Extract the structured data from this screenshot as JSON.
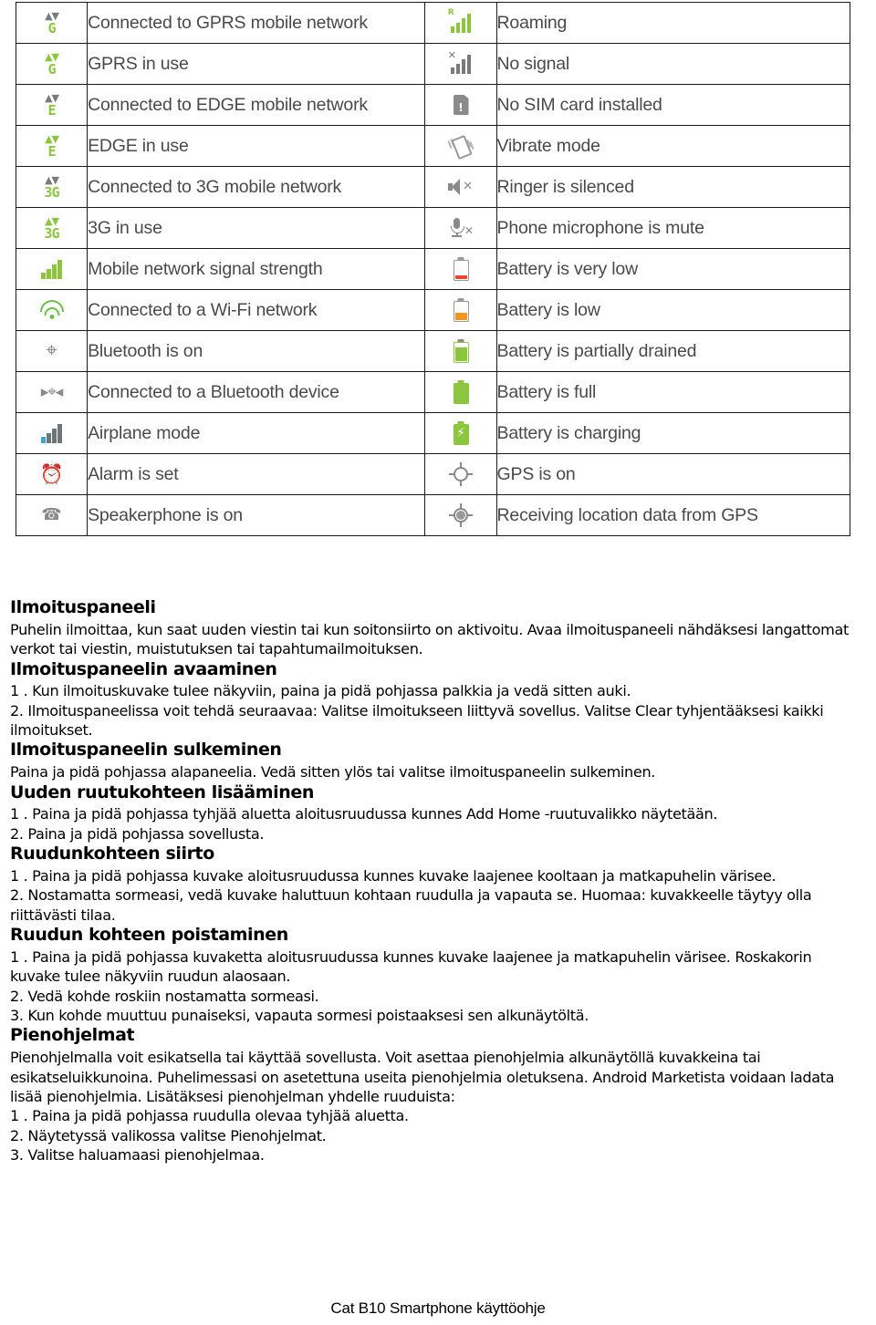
{
  "status_icons_table": {
    "rows": [
      {
        "left": {
          "icon": "gprs-connected-icon",
          "label": "Connected to GPRS mobile network"
        },
        "right": {
          "icon": "roaming-icon",
          "label": "Roaming"
        }
      },
      {
        "left": {
          "icon": "gprs-in-use-icon",
          "label": "GPRS in use"
        },
        "right": {
          "icon": "no-signal-icon",
          "label": "No signal"
        }
      },
      {
        "left": {
          "icon": "edge-connected-icon",
          "label": "Connected to EDGE mobile network"
        },
        "right": {
          "icon": "no-sim-card-icon",
          "label": "No SIM card installed"
        }
      },
      {
        "left": {
          "icon": "edge-in-use-icon",
          "label": "EDGE in use"
        },
        "right": {
          "icon": "vibrate-mode-icon",
          "label": "Vibrate mode"
        }
      },
      {
        "left": {
          "icon": "3g-connected-icon",
          "label": "Connected to 3G mobile network"
        },
        "right": {
          "icon": "ringer-silenced-icon",
          "label": "Ringer is silenced"
        }
      },
      {
        "left": {
          "icon": "3g-in-use-icon",
          "label": "3G in use"
        },
        "right": {
          "icon": "microphone-mute-icon",
          "label": "Phone microphone is mute"
        }
      },
      {
        "left": {
          "icon": "signal-strength-icon",
          "label": "Mobile network signal strength"
        },
        "right": {
          "icon": "battery-very-low-icon",
          "label": "Battery is very low"
        }
      },
      {
        "left": {
          "icon": "wifi-connected-icon",
          "label": "Connected to a Wi-Fi network"
        },
        "right": {
          "icon": "battery-low-icon",
          "label": "Battery is low"
        }
      },
      {
        "left": {
          "icon": "bluetooth-on-icon",
          "label": "Bluetooth is on"
        },
        "right": {
          "icon": "battery-partial-icon",
          "label": "Battery is partially drained"
        }
      },
      {
        "left": {
          "icon": "bluetooth-connected-icon",
          "label": "Connected to a Bluetooth device"
        },
        "right": {
          "icon": "battery-full-icon",
          "label": "Battery is full"
        }
      },
      {
        "left": {
          "icon": "airplane-mode-icon",
          "label": "Airplane mode"
        },
        "right": {
          "icon": "battery-charging-icon",
          "label": "Battery is charging"
        }
      },
      {
        "left": {
          "icon": "alarm-set-icon",
          "label": "Alarm is set"
        },
        "right": {
          "icon": "gps-on-icon",
          "label": "GPS is on"
        }
      },
      {
        "left": {
          "icon": "speakerphone-on-icon",
          "label": "Speakerphone is on"
        },
        "right": {
          "icon": "gps-receiving-icon",
          "label": "Receiving location data from GPS"
        }
      }
    ]
  },
  "document": {
    "h_ilmoituspaneeli": "Ilmoituspaneeli",
    "p_intro": "Puhelin ilmoittaa, kun saat uuden viestin tai kun soitonsiirto on aktivoitu. Avaa ilmoituspaneeli nähdäksesi langattomat verkot tai viestin, muistutuksen tai tapahtumailmoituksen.",
    "h_avaaminen": "Ilmoituspaneelin avaaminen",
    "p_avaaminen_1": "1 . Kun ilmoituskuvake tulee näkyviin, paina ja pidä pohjassa palkkia ja vedä sitten auki.",
    "p_avaaminen_2": "2. Ilmoituspaneelissa voit tehdä seuraavaa: Valitse ilmoitukseen liittyvä sovellus. Valitse Clear tyhjentääksesi kaikki ilmoitukset.",
    "h_sulkeminen": "Ilmoituspaneelin sulkeminen",
    "p_sulkeminen": "Paina ja pidä pohjassa alapaneelia. Vedä sitten ylös tai valitse ilmoituspaneelin sulkeminen.",
    "h_lisaaminen": "Uuden ruutukohteen lisääminen",
    "p_lisaaminen_1": "1 . Paina ja pidä pohjassa tyhjää aluetta aloitusruudussa kunnes Add Home -ruutuvalikko näytetään.",
    "p_lisaaminen_2": "2. Paina ja pidä pohjassa sovellusta.",
    "h_siirto": "Ruudunkohteen siirto",
    "p_siirto_1": "1 . Paina ja pidä pohjassa kuvake aloitusruudussa kunnes kuvake laajenee kooltaan ja matkapuhelin värisee.",
    "p_siirto_2": "2. Nostamatta sormeasi, vedä kuvake haluttuun kohtaan ruudulla ja vapauta se. Huomaa: kuvakkeelle täytyy olla riittävästi tilaa.",
    "h_poistaminen": "Ruudun kohteen poistaminen",
    "p_poistaminen_1": "1 . Paina ja pidä pohjassa kuvaketta aloitusruudussa kunnes kuvake laajenee ja matkapuhelin värisee. Roskakorin kuvake tulee näkyviin ruudun alaosaan.",
    "p_poistaminen_2": "2. Vedä kohde roskiin nostamatta sormeasi.",
    "p_poistaminen_3": "3. Kun kohde muuttuu punaiseksi, vapauta sormesi poistaaksesi sen alkunäytöltä.",
    "h_pienohjelmat": "Pienohjelmat",
    "p_pienohjelmat": "Pienohjelmalla voit esikatsella tai käyttää sovellusta. Voit asettaa pienohjelmia alkunäytöllä kuvakkeina tai esikatseluikkunoina. Puhelimessasi on asetettuna useita pienohjelmia oletuksena. Android Marketista voidaan ladata lisää pienohjelmia. Lisätäksesi pienohjelman yhdelle ruuduista:",
    "p_pienohjelmat_1": "1 . Paina ja pidä pohjassa ruudulla olevaa tyhjää aluetta.",
    "p_pienohjelmat_2": "2. Näytetyssä valikossa valitse Pienohjelmat.",
    "p_pienohjelmat_3": "3. Valitse haluamaasi pienohjelmaa."
  },
  "footer": {
    "text": "Cat B10 Smartphone käyttöohje"
  },
  "colors": {
    "android_green": "#8cc63e",
    "wifi_green": "#6cc04a",
    "battery_red": "#f0442e",
    "battery_orange": "#f7941e",
    "icon_gray": "#8a8a8a",
    "text_gray": "#4a4a4a",
    "airplane_blue": "#3aa6d8"
  }
}
